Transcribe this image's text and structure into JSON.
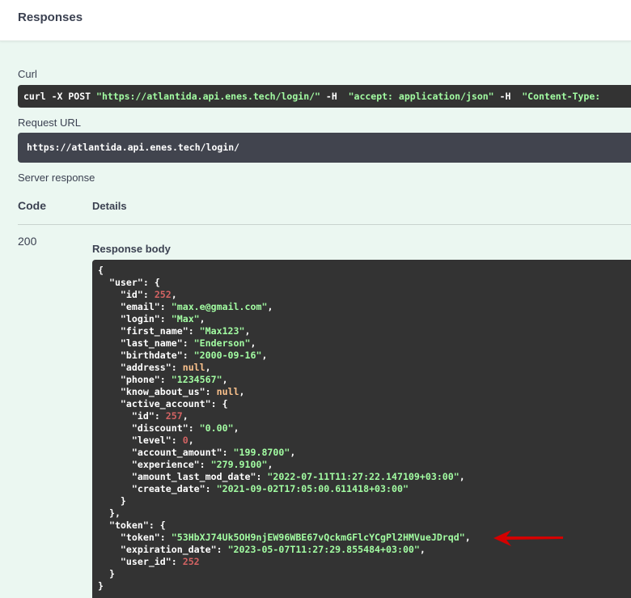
{
  "header": {
    "title": "Responses"
  },
  "curl": {
    "label": "Curl",
    "cmd_prefix": "curl -X POST ",
    "url": "\"https://atlantida.api.enes.tech/login/\"",
    "h1": " -H  ",
    "accept": "\"accept: application/json\"",
    "h2": " -H  ",
    "content_type": "\"Content-Type: "
  },
  "request_url": {
    "label": "Request URL",
    "value": "https://atlantida.api.enes.tech/login/"
  },
  "server_response": {
    "label": "Server response",
    "code_header": "Code",
    "details_header": "Details",
    "code": "200",
    "response_body_label": "Response body"
  },
  "response_body": [
    [
      [
        "p",
        "{"
      ]
    ],
    [
      [
        "p",
        "  "
      ],
      [
        "k",
        "\"user\""
      ],
      [
        "p",
        ": {"
      ]
    ],
    [
      [
        "p",
        "    "
      ],
      [
        "k",
        "\"id\""
      ],
      [
        "p",
        ": "
      ],
      [
        "n",
        "252"
      ],
      [
        "p",
        ","
      ]
    ],
    [
      [
        "p",
        "    "
      ],
      [
        "k",
        "\"email\""
      ],
      [
        "p",
        ": "
      ],
      [
        "s",
        "\"max.e@gmail.com\""
      ],
      [
        "p",
        ","
      ]
    ],
    [
      [
        "p",
        "    "
      ],
      [
        "k",
        "\"login\""
      ],
      [
        "p",
        ": "
      ],
      [
        "s",
        "\"Max\""
      ],
      [
        "p",
        ","
      ]
    ],
    [
      [
        "p",
        "    "
      ],
      [
        "k",
        "\"first_name\""
      ],
      [
        "p",
        ": "
      ],
      [
        "s",
        "\"Max123\""
      ],
      [
        "p",
        ","
      ]
    ],
    [
      [
        "p",
        "    "
      ],
      [
        "k",
        "\"last_name\""
      ],
      [
        "p",
        ": "
      ],
      [
        "s",
        "\"Enderson\""
      ],
      [
        "p",
        ","
      ]
    ],
    [
      [
        "p",
        "    "
      ],
      [
        "k",
        "\"birthdate\""
      ],
      [
        "p",
        ": "
      ],
      [
        "s",
        "\"2000-09-16\""
      ],
      [
        "p",
        ","
      ]
    ],
    [
      [
        "p",
        "    "
      ],
      [
        "k",
        "\"address\""
      ],
      [
        "p",
        ": "
      ],
      [
        "l",
        "null"
      ],
      [
        "p",
        ","
      ]
    ],
    [
      [
        "p",
        "    "
      ],
      [
        "k",
        "\"phone\""
      ],
      [
        "p",
        ": "
      ],
      [
        "s",
        "\"1234567\""
      ],
      [
        "p",
        ","
      ]
    ],
    [
      [
        "p",
        "    "
      ],
      [
        "k",
        "\"know_about_us\""
      ],
      [
        "p",
        ": "
      ],
      [
        "l",
        "null"
      ],
      [
        "p",
        ","
      ]
    ],
    [
      [
        "p",
        "    "
      ],
      [
        "k",
        "\"active_account\""
      ],
      [
        "p",
        ": {"
      ]
    ],
    [
      [
        "p",
        "      "
      ],
      [
        "k",
        "\"id\""
      ],
      [
        "p",
        ": "
      ],
      [
        "n",
        "257"
      ],
      [
        "p",
        ","
      ]
    ],
    [
      [
        "p",
        "      "
      ],
      [
        "k",
        "\"discount\""
      ],
      [
        "p",
        ": "
      ],
      [
        "s",
        "\"0.00\""
      ],
      [
        "p",
        ","
      ]
    ],
    [
      [
        "p",
        "      "
      ],
      [
        "k",
        "\"level\""
      ],
      [
        "p",
        ": "
      ],
      [
        "n",
        "0"
      ],
      [
        "p",
        ","
      ]
    ],
    [
      [
        "p",
        "      "
      ],
      [
        "k",
        "\"account_amount\""
      ],
      [
        "p",
        ": "
      ],
      [
        "s",
        "\"199.8700\""
      ],
      [
        "p",
        ","
      ]
    ],
    [
      [
        "p",
        "      "
      ],
      [
        "k",
        "\"experience\""
      ],
      [
        "p",
        ": "
      ],
      [
        "s",
        "\"279.9100\""
      ],
      [
        "p",
        ","
      ]
    ],
    [
      [
        "p",
        "      "
      ],
      [
        "k",
        "\"amount_last_mod_date\""
      ],
      [
        "p",
        ": "
      ],
      [
        "s",
        "\"2022-07-11T11:27:22.147109+03:00\""
      ],
      [
        "p",
        ","
      ]
    ],
    [
      [
        "p",
        "      "
      ],
      [
        "k",
        "\"create_date\""
      ],
      [
        "p",
        ": "
      ],
      [
        "s",
        "\"2021-09-02T17:05:00.611418+03:00\""
      ]
    ],
    [
      [
        "p",
        "    }"
      ]
    ],
    [
      [
        "p",
        "  },"
      ]
    ],
    [
      [
        "p",
        "  "
      ],
      [
        "k",
        "\"token\""
      ],
      [
        "p",
        ": {"
      ]
    ],
    [
      [
        "p",
        "    "
      ],
      [
        "k",
        "\"token\""
      ],
      [
        "p",
        ": "
      ],
      [
        "s",
        "\"53HbXJ74Uk5OH9njEW96WBE67vQckmGFlcYCgPl2HMVueJDrqd\""
      ],
      [
        "p",
        ","
      ]
    ],
    [
      [
        "p",
        "    "
      ],
      [
        "k",
        "\"expiration_date\""
      ],
      [
        "p",
        ": "
      ],
      [
        "s",
        "\"2023-05-07T11:27:29.855484+03:00\""
      ],
      [
        "p",
        ","
      ]
    ],
    [
      [
        "p",
        "    "
      ],
      [
        "k",
        "\"user_id\""
      ],
      [
        "p",
        ": "
      ],
      [
        "n",
        "252"
      ]
    ],
    [
      [
        "p",
        "  }"
      ]
    ],
    [
      [
        "p",
        "}"
      ]
    ]
  ],
  "colors": {
    "arrow": "#d40000",
    "string": "#a2fca2",
    "number": "#d36363",
    "null": "#fcc28c"
  }
}
